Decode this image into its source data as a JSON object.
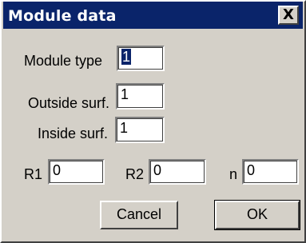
{
  "window": {
    "title": "Module data",
    "close_glyph": "X"
  },
  "fields": {
    "module_type": {
      "label": "Module type",
      "value": "1"
    },
    "outside_surf": {
      "label": "Outside surf.",
      "value": "1"
    },
    "inside_surf": {
      "label": "Inside surf.",
      "value": "1"
    },
    "r1": {
      "label": "R1",
      "value": "0"
    },
    "r2": {
      "label": "R2",
      "value": "0"
    },
    "n": {
      "label": "n",
      "value": "0"
    }
  },
  "buttons": {
    "cancel": "Cancel",
    "ok": "OK"
  },
  "colors": {
    "titlebar": "#0a246a",
    "face": "#d4d0c8"
  }
}
